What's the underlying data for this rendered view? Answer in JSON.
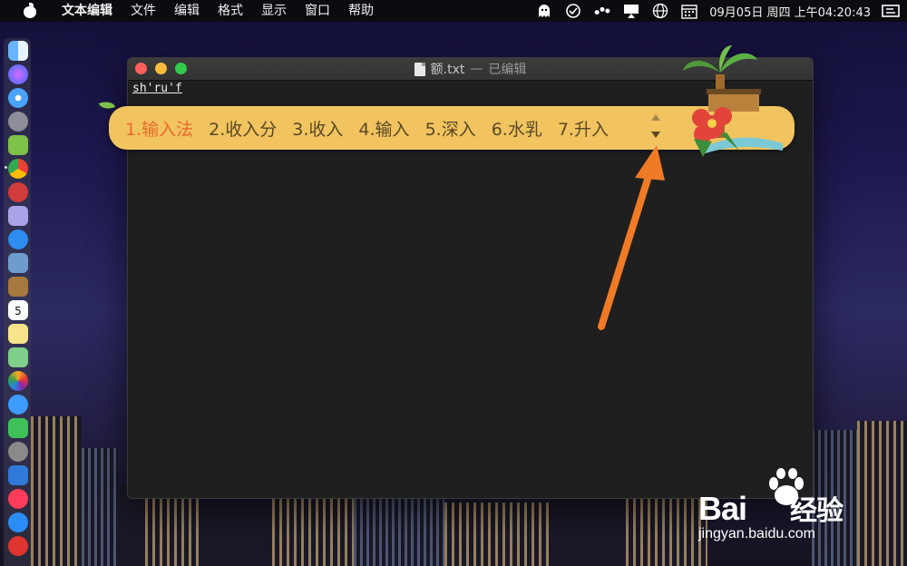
{
  "menubar": {
    "app_name": "文本编辑",
    "items": [
      "文件",
      "编辑",
      "格式",
      "显示",
      "窗口",
      "帮助"
    ],
    "clock": "09月05日 周四 上午04:20:43",
    "status_icons": [
      "ghost-icon",
      "globe-check-icon",
      "dots-icon",
      "airplay-icon",
      "globe-icon",
      "calendar-icon",
      "input-source-icon"
    ]
  },
  "window": {
    "filename": "额.txt",
    "separator": "—",
    "status": "已编辑",
    "typed_text": "sh'ru'f"
  },
  "ime": {
    "candidates": [
      "1.输入法",
      "2.收入分",
      "3.收入",
      "4.输入",
      "5.深入",
      "6.水乳",
      "7.升入"
    ],
    "selected_index": 0,
    "selected_color": "#ea6a2a",
    "bar_color": "#f1c45f"
  },
  "annotation": {
    "arrow_color": "#f07a25"
  },
  "dock": {
    "icons": [
      "finder-icon",
      "siri-icon",
      "safari-icon",
      "launchpad-icon",
      "android-icon",
      "chrome-icon",
      "app-icon",
      "notes-icon",
      "xcode-icon",
      "preview-icon",
      "notebook-icon",
      "calendar-icon",
      "stickies-icon",
      "maps-icon",
      "photos-icon",
      "messages-icon",
      "facetime-icon",
      "system-preferences-icon",
      "keynote-icon",
      "music-icon",
      "app-store-icon",
      "vivaldi-icon"
    ],
    "calendar_day": "5"
  },
  "watermark": {
    "brand": "Bai",
    "brand_cn": "经验",
    "url": "jingyan.baidu.com"
  }
}
